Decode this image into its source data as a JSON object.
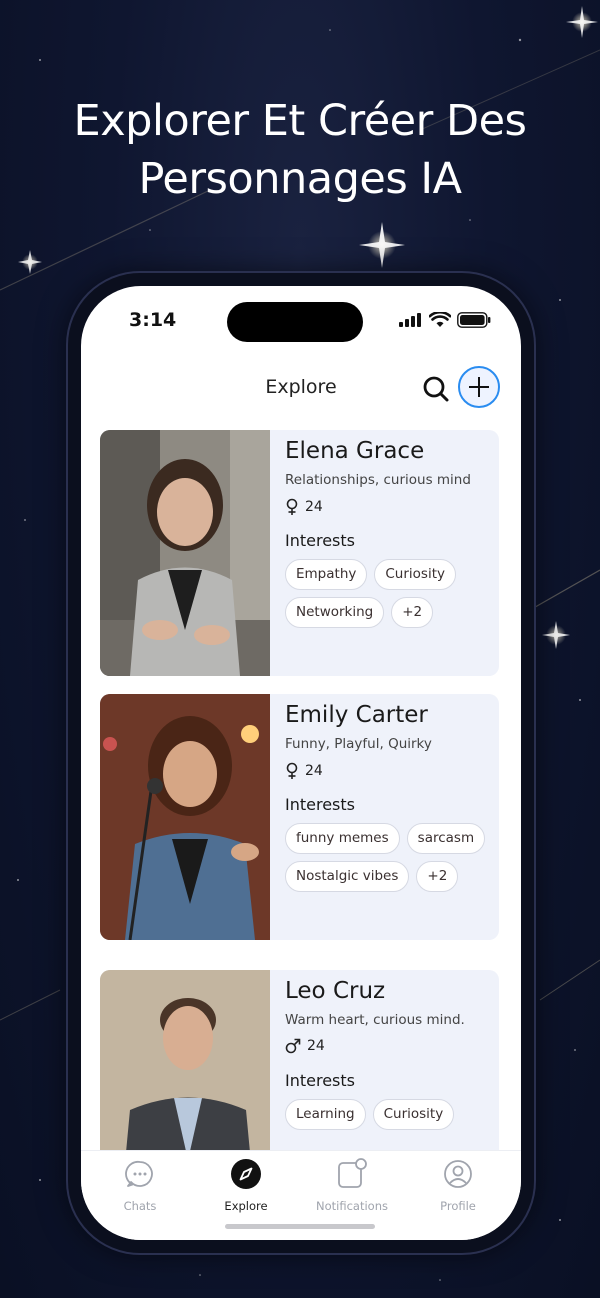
{
  "headline": {
    "line1": "Explorer Et Créer Des",
    "line2": "Personnages IA"
  },
  "status_bar": {
    "time": "3:14"
  },
  "header": {
    "title": "Explore"
  },
  "interests_label": "Interests",
  "characters": [
    {
      "name": "Elena Grace",
      "tagline": "Relationships, curious mind",
      "gender_icon": "female-icon",
      "age": "24",
      "interests": [
        "Empathy",
        "Curiosity",
        "Networking",
        "+2"
      ]
    },
    {
      "name": "Emily Carter",
      "tagline": "Funny, Playful, Quirky",
      "gender_icon": "female-icon",
      "age": "24",
      "interests": [
        "funny memes",
        "sarcasm",
        "Nostalgic vibes",
        "+2"
      ]
    },
    {
      "name": "Leo Cruz",
      "tagline": "Warm heart, curious mind.",
      "gender_icon": "male-icon",
      "age": "24",
      "interests": [
        "Learning",
        "Curiosity"
      ]
    }
  ],
  "tabbar": {
    "items": [
      {
        "label": "Chats",
        "icon": "chat-icon"
      },
      {
        "label": "Explore",
        "icon": "compass-icon",
        "active": true
      },
      {
        "label": "Notifications",
        "icon": "bell-icon"
      },
      {
        "label": "Profile",
        "icon": "profile-icon"
      }
    ]
  },
  "colors": {
    "accent": "#2a8cf0",
    "card_bg": "#eff2fa",
    "background": "#0f1630"
  }
}
